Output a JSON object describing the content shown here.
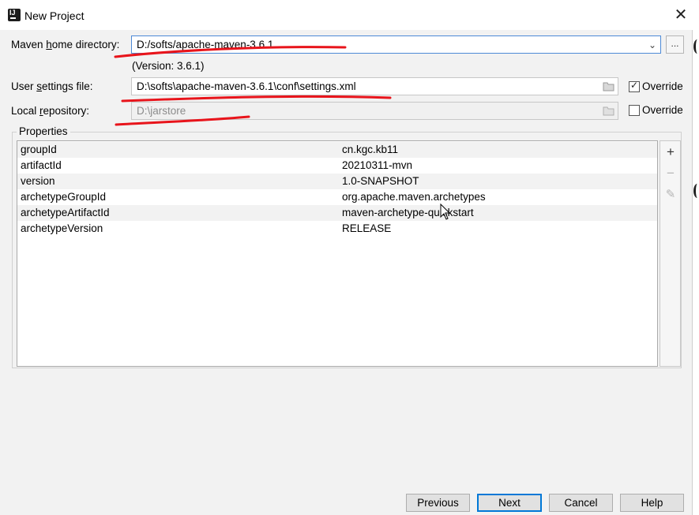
{
  "window": {
    "title": "New Project",
    "app_icon": "intellij-icon",
    "close_glyph": "✕"
  },
  "maven": {
    "home_label_pre": "Maven ",
    "home_label_u": "h",
    "home_label_post": "ome directory:",
    "home_value": "D:/softs/apache-maven-3.6.1",
    "version_text": "(Version: 3.6.1)",
    "browse_label": "...",
    "settings_label_pre": "User ",
    "settings_label_u": "s",
    "settings_label_post": "ettings file:",
    "settings_value": "D:\\softs\\apache-maven-3.6.1\\conf\\settings.xml",
    "settings_override_label": "Override",
    "settings_override_checked": true,
    "repo_label_pre": "Local ",
    "repo_label_u": "r",
    "repo_label_post": "epository:",
    "repo_value": "D:\\jarstore",
    "repo_override_label": "Override",
    "repo_override_checked": false
  },
  "properties": {
    "title": "Properties",
    "rows": [
      {
        "key": "groupId",
        "value": "cn.kgc.kb11"
      },
      {
        "key": "artifactId",
        "value": "20210311-mvn"
      },
      {
        "key": "version",
        "value": "1.0-SNAPSHOT"
      },
      {
        "key": "archetypeGroupId",
        "value": "org.apache.maven.archetypes"
      },
      {
        "key": "archetypeArtifactId",
        "value": "maven-archetype-quickstart"
      },
      {
        "key": "archetypeVersion",
        "value": "RELEASE"
      }
    ],
    "tools": {
      "add": "+",
      "remove": "−",
      "edit": "✎"
    }
  },
  "buttons": {
    "previous": "Previous",
    "next": "Next",
    "cancel": "Cancel",
    "help": "Help"
  },
  "colors": {
    "annotation": "#e8141b",
    "focus": "#0078d7"
  }
}
